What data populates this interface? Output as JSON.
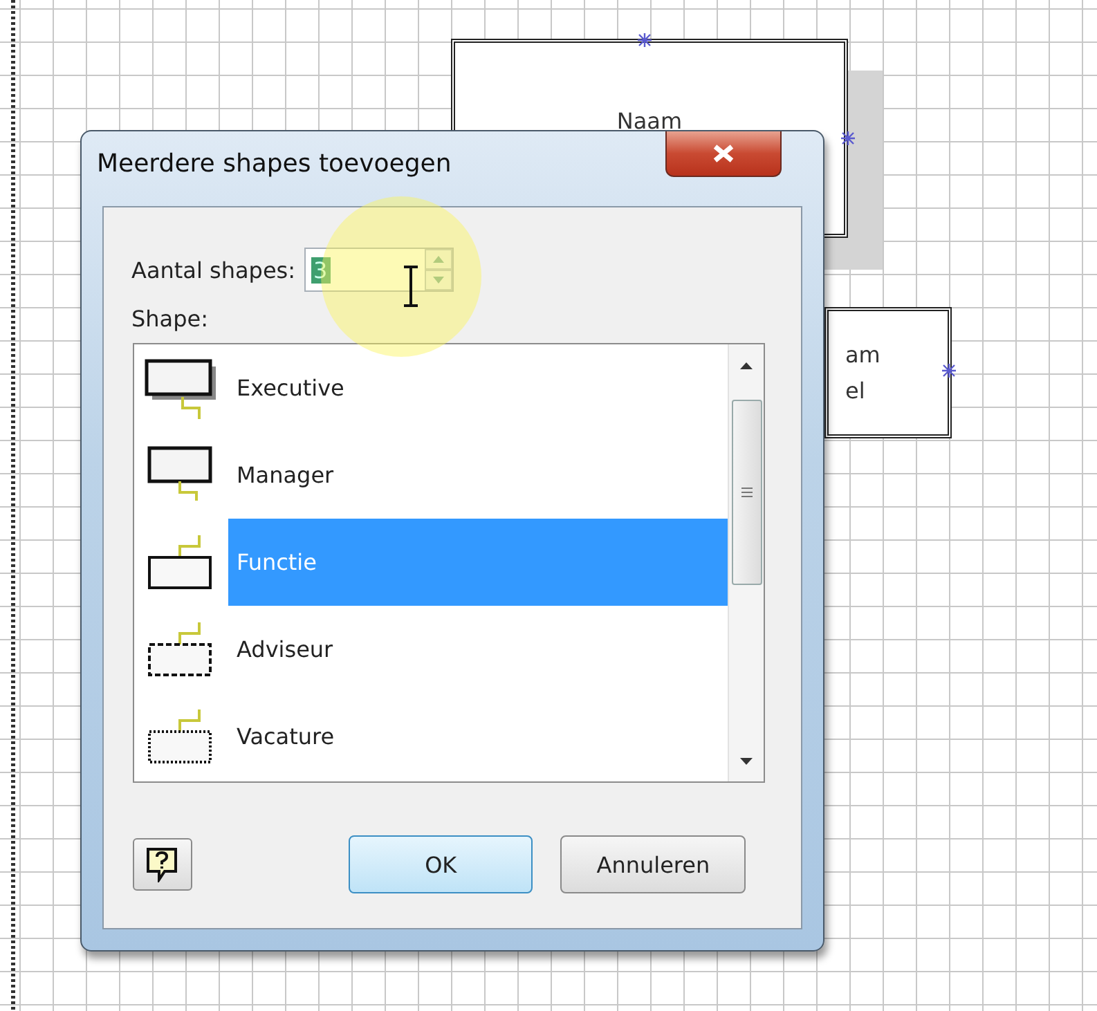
{
  "canvas": {
    "shapes": [
      {
        "lines": [
          "Naam"
        ]
      },
      {
        "lines": [
          "am",
          "el"
        ]
      }
    ]
  },
  "dialog": {
    "title": "Meerdere shapes toevoegen",
    "count_label": "Aantal shapes:",
    "count_value": "3",
    "value_selected": true,
    "shape_label": "Shape:",
    "shapes": [
      {
        "label": "Executive",
        "kind": "executive",
        "selected": false
      },
      {
        "label": "Manager",
        "kind": "manager",
        "selected": false
      },
      {
        "label": "Functie",
        "kind": "functie",
        "selected": true
      },
      {
        "label": "Adviseur",
        "kind": "adviseur",
        "selected": false
      },
      {
        "label": "Vacature",
        "kind": "vacature",
        "selected": false
      }
    ],
    "ok": "OK",
    "cancel": "Annuleren"
  }
}
